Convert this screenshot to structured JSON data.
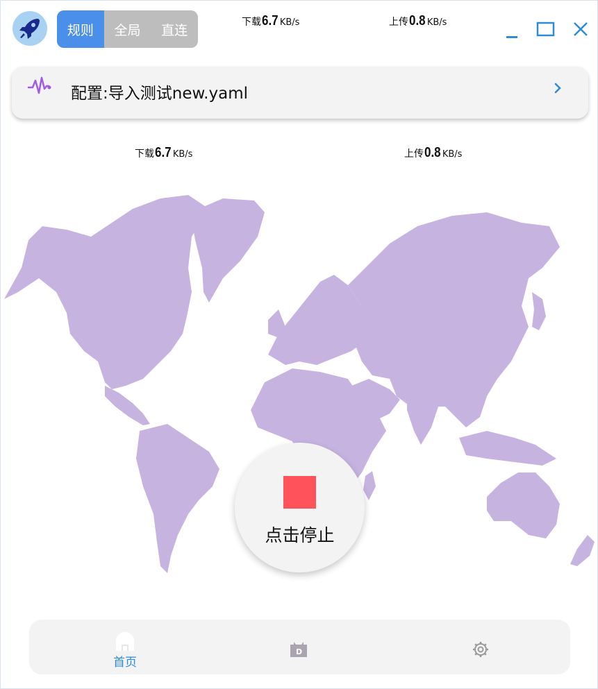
{
  "modes": {
    "items": [
      "规则",
      "全局",
      "直连"
    ],
    "active": "规则"
  },
  "header_speed": {
    "download_label": "下载",
    "download_value": "6.7",
    "download_unit": "KB/s",
    "upload_label": "上传",
    "upload_value": "0.8",
    "upload_unit": "KB/s"
  },
  "window_controls": {
    "icons": [
      "minimize-icon",
      "maximize-icon",
      "close-icon"
    ],
    "color": "#2e8bd6"
  },
  "config": {
    "label": "配置:导入测试new.yaml",
    "icon": "activity-pulse-icon",
    "arrow": "chevron-right-icon"
  },
  "map_speed": {
    "download_label": "下载",
    "download_value": "6.7",
    "download_unit": "KB/s",
    "upload_label": "上传",
    "upload_value": "0.8",
    "upload_unit": "KB/s"
  },
  "stop_button": {
    "label": "点击停止",
    "color": "#ff525a"
  },
  "bottom_nav": {
    "home_label": "首页",
    "home_icon": "home-icon",
    "proxy_icon": "dashboard-icon",
    "settings_icon": "gear-icon"
  },
  "colors": {
    "accent": "#4a8fe9",
    "map": "#c7b3e0",
    "nav_active": "#2e8bd6",
    "card_bg": "#f3f3f3"
  }
}
